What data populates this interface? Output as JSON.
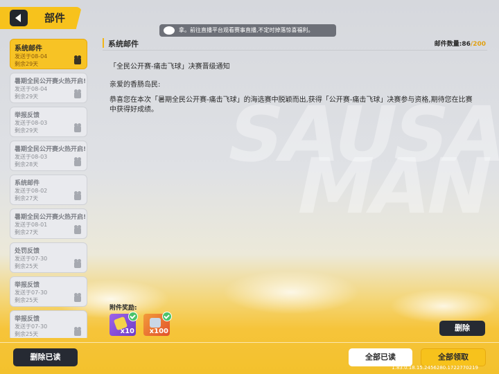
{
  "header": {
    "title": "部件"
  },
  "notice": {
    "text": "拿。前往直播平台观看赛事直播,不定时掉落惊喜福利。"
  },
  "mail_list": [
    {
      "title": "系统邮件",
      "sent": "发送于08-04",
      "remain": "剩余29天",
      "selected": true
    },
    {
      "title": "暑期全民公开赛火热开启!",
      "sent": "发送于08-04",
      "remain": "剩余29天"
    },
    {
      "title": "举报反馈",
      "sent": "发送于08-03",
      "remain": "剩余29天"
    },
    {
      "title": "暑期全民公开赛火热开启!",
      "sent": "发送于08-03",
      "remain": "剩余28天"
    },
    {
      "title": "系统邮件",
      "sent": "发送于08-02",
      "remain": "剩余27天"
    },
    {
      "title": "暑期全民公开赛火热开启!",
      "sent": "发送于08-01",
      "remain": "剩余27天"
    },
    {
      "title": "处罚反馈",
      "sent": "发送于07-30",
      "remain": "剩余25天"
    },
    {
      "title": "举报反馈",
      "sent": "发送于07-30",
      "remain": "剩余25天"
    },
    {
      "title": "举报反馈",
      "sent": "发送于07-30",
      "remain": "剩余25天"
    }
  ],
  "mail": {
    "header_title": "系统邮件",
    "count_label": "邮件数量:86",
    "count_max": "/200",
    "subject": "「全民公开赛-痛击飞球」决赛晋级通知",
    "greeting": "亲爱的香肠岛民:",
    "body": "恭喜您在本次「暑期全民公开赛-痛击飞球」的海选赛中脱颖而出,获得「公开赛-痛击飞球」决赛参与资格,期待您在比赛中获得好成绩。",
    "attach_label": "附件奖励:",
    "rewards": [
      {
        "qty": "x10",
        "color": "#8a4fe0",
        "icon": "ticket-icon"
      },
      {
        "qty": "x100",
        "color": "#ea7a33",
        "icon": "parcel-icon"
      }
    ]
  },
  "buttons": {
    "delete": "删除",
    "delete_read": "删除已读",
    "read_all": "全部已读",
    "claim_all": "全部领取"
  },
  "version": "1.83.0.18.15.2456280.1722770219"
}
